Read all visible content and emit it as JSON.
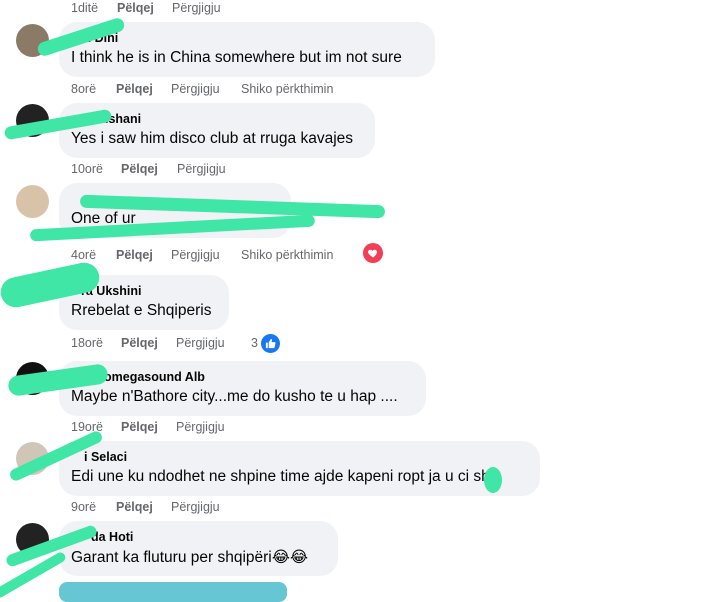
{
  "actions": {
    "like": "Pëlqej",
    "reply": "Përgjigju",
    "translate": "Shiko përkthimin"
  },
  "top_meta": {
    "time": "1ditë"
  },
  "comments": [
    {
      "name": "Din Dini",
      "text": "I think he is in China somewhere but im not sure",
      "time": "8orë",
      "see_translation": true
    },
    {
      "name": "t Elshani",
      "text": "Yes i saw him disco club at rruga kavajes",
      "time": "10orë"
    },
    {
      "name": "",
      "text": "One of ur",
      "time": "4orë",
      "see_translation": true,
      "reaction": "love"
    },
    {
      "name": "ra Ukshini",
      "text": "Rrebelat e Shqiperis",
      "time": "18orë",
      "reaction_count": "3",
      "reaction": "like"
    },
    {
      "name": "omegasound Alb",
      "text": "Maybe n'Bathore city...me do kusho te u hap ....",
      "time": "19orë"
    },
    {
      "name": "i Selaci",
      "text": "Edi une ku ndodhet ne shpine time ajde kapeni ropt ja u ci sha",
      "time": "9orë"
    },
    {
      "name": "da Hoti",
      "text": "Garant ka fluturu per shqipëri😂😂",
      "time": ""
    }
  ],
  "colors": {
    "bubble": "#f0f2f5",
    "meta": "#65676b",
    "scribble": "#3fe6a5",
    "like_blue": "#1877f2",
    "love_red": "#f33e58"
  }
}
